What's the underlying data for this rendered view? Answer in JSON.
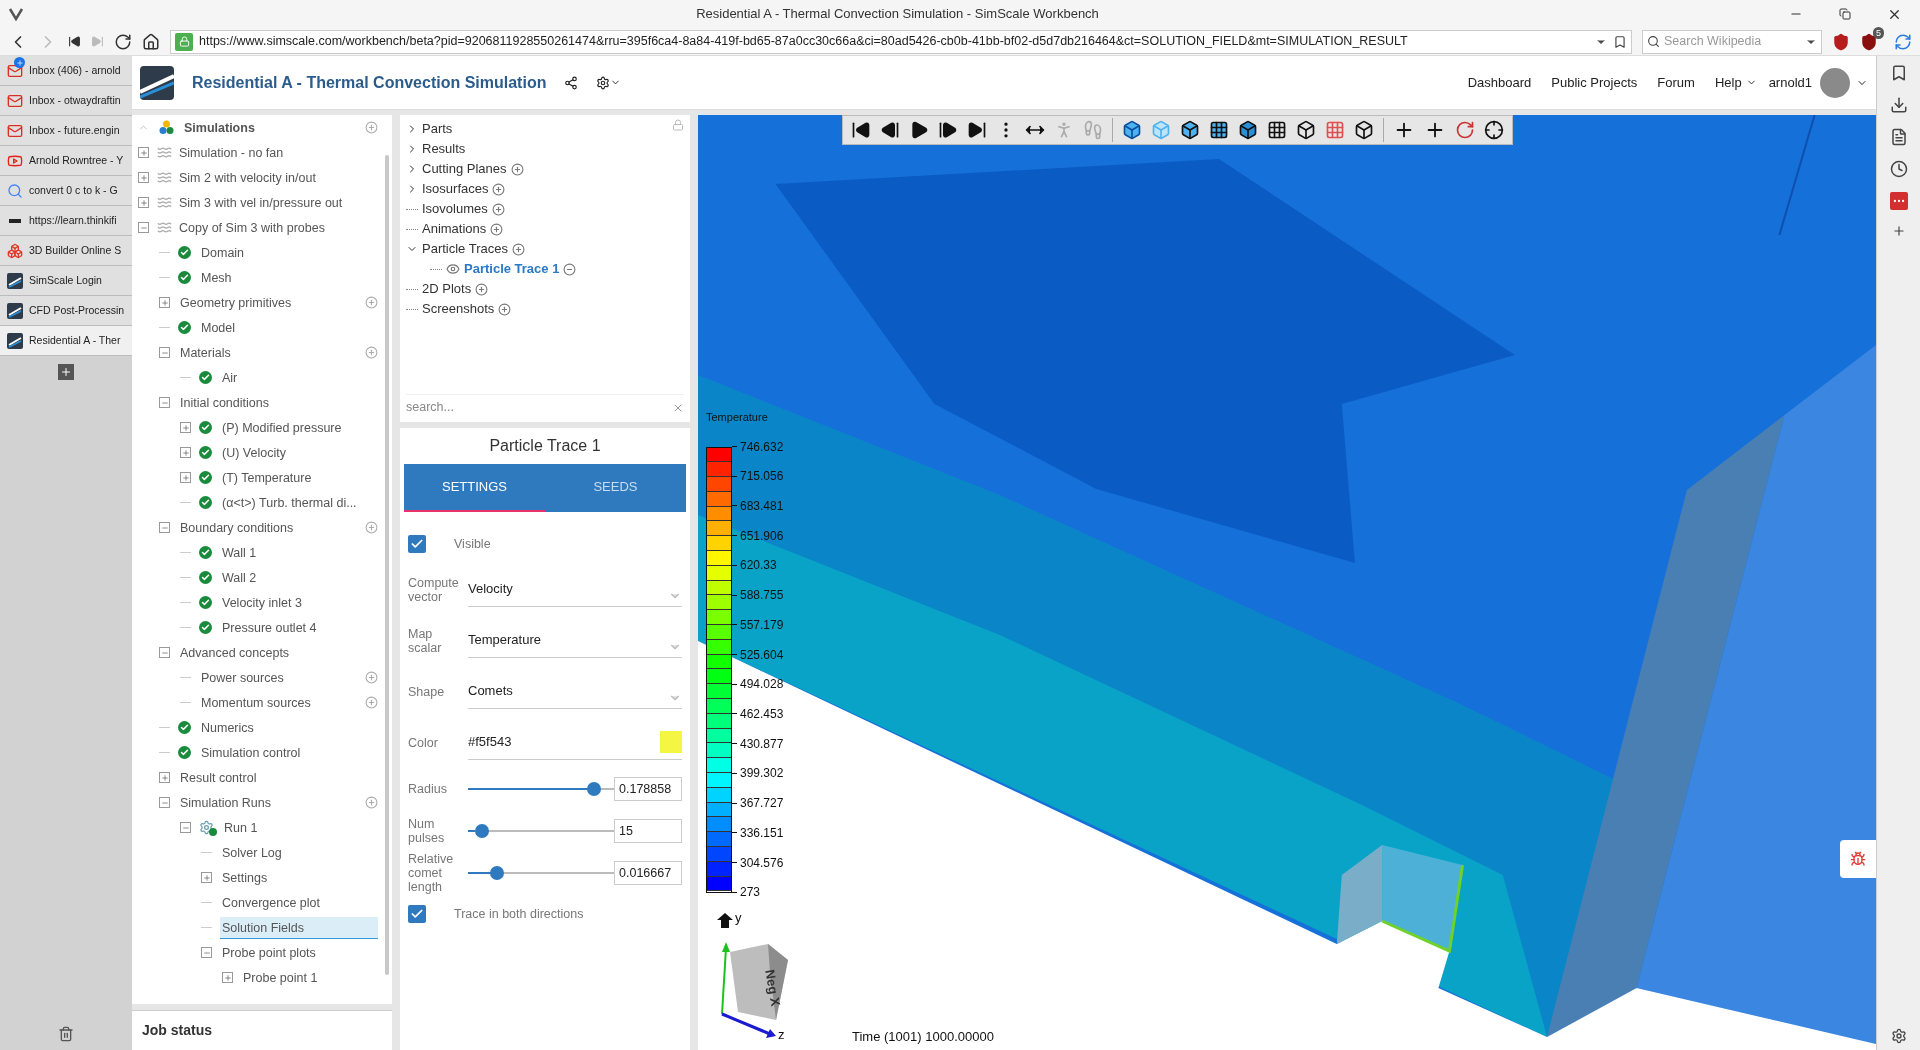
{
  "browser": {
    "title": "Residential A - Thermal Convection Simulation - SimScale Workbench",
    "url": "https://www.simscale.com/workbench/beta?pid=9206811928550261474&rru=395f6ca4-8a84-419f-bd65-87a0cc30c66a&ci=80ad5426-cb0b-41bb-bf02-d5d7db216464&ct=SOLUTION_FIELD&mt=SIMULATION_RESULT",
    "search_placeholder": "Search Wikipedia",
    "extension_badge": "5",
    "tabs": [
      {
        "label": "Inbox (406) - arnold",
        "kind": "mail",
        "badge": true,
        "selected": false
      },
      {
        "label": "Inbox - otwaydraftin",
        "kind": "mail",
        "badge": false,
        "selected": false
      },
      {
        "label": "Inbox - future.engin",
        "kind": "mail",
        "badge": false,
        "selected": false
      },
      {
        "label": "Arnold Rowntree - Y",
        "kind": "video",
        "badge": false,
        "selected": false
      },
      {
        "label": "convert 0 c to k - G",
        "kind": "search",
        "badge": false,
        "selected": false
      },
      {
        "label": "https://learn.thinkifi",
        "kind": "course",
        "badge": false,
        "selected": false
      },
      {
        "label": "3D Builder Online S",
        "kind": "builder",
        "badge": false,
        "selected": false
      },
      {
        "label": "SimScale Login",
        "kind": "app",
        "badge": false,
        "selected": false
      },
      {
        "label": "CFD Post-Processin",
        "kind": "app",
        "badge": false,
        "selected": false
      },
      {
        "label": "Residential A - Ther",
        "kind": "app",
        "badge": false,
        "selected": true
      }
    ]
  },
  "app_header": {
    "title": "Residential A - Thermal Convection Simulation",
    "nav": [
      {
        "label": "Dashboard",
        "dropdown": false
      },
      {
        "label": "Public Projects",
        "dropdown": false
      },
      {
        "label": "Forum",
        "dropdown": false
      },
      {
        "label": "Help",
        "dropdown": true
      }
    ],
    "user": "arnold1"
  },
  "simulation_tree": [
    {
      "label": "Simulations",
      "kind": "root",
      "expanded": true,
      "add": true,
      "selected": false,
      "children": [
        {
          "label": "Simulation - no fan",
          "kind": "sim",
          "expanded": false,
          "selected": false
        },
        {
          "label": "Sim 2 with velocity in/out",
          "kind": "sim",
          "expanded": false,
          "selected": false
        },
        {
          "label": "Sim 3 with vel in/pressure out",
          "kind": "sim",
          "expanded": false,
          "selected": false
        },
        {
          "label": "Copy of Sim 3 with probes",
          "kind": "sim",
          "expanded": true,
          "selected": false,
          "children": [
            {
              "label": "Domain",
              "kind": "check",
              "selected": false
            },
            {
              "label": "Mesh",
              "kind": "check",
              "selected": false
            },
            {
              "label": "Geometry primitives",
              "expanded": false,
              "add": true,
              "selected": false
            },
            {
              "label": "Model",
              "kind": "check",
              "selected": false
            },
            {
              "label": "Materials",
              "expanded": true,
              "add": true,
              "selected": false,
              "children": [
                {
                  "label": "Air",
                  "kind": "check",
                  "selected": false
                }
              ]
            },
            {
              "label": "Initial conditions",
              "expanded": true,
              "selected": false,
              "children": [
                {
                  "label": "(P) Modified pressure",
                  "kind": "check",
                  "expanded": false,
                  "selected": false
                },
                {
                  "label": "(U) Velocity",
                  "kind": "check",
                  "expanded": false,
                  "selected": false
                },
                {
                  "label": "(T) Temperature",
                  "kind": "check",
                  "expanded": false,
                  "selected": false
                },
                {
                  "label": "(α<t>) Turb. thermal di...",
                  "kind": "check",
                  "selected": false
                }
              ]
            },
            {
              "label": "Boundary conditions",
              "expanded": true,
              "add": true,
              "selected": false,
              "children": [
                {
                  "label": "Wall 1",
                  "kind": "check",
                  "selected": false
                },
                {
                  "label": "Wall 2",
                  "kind": "check",
                  "selected": false
                },
                {
                  "label": "Velocity inlet 3",
                  "kind": "check",
                  "selected": false
                },
                {
                  "label": "Pressure outlet 4",
                  "kind": "check",
                  "selected": false
                }
              ]
            },
            {
              "label": "Advanced concepts",
              "expanded": true,
              "selected": false,
              "children": [
                {
                  "label": "Power sources",
                  "add": true,
                  "selected": false
                },
                {
                  "label": "Momentum sources",
                  "add": true,
                  "selected": false
                }
              ]
            },
            {
              "label": "Numerics",
              "kind": "check",
              "selected": false
            },
            {
              "label": "Simulation control",
              "kind": "check",
              "selected": false
            },
            {
              "label": "Result control",
              "expanded": false,
              "selected": false
            },
            {
              "label": "Simulation Runs",
              "expanded": true,
              "add": true,
              "selected": false,
              "children": [
                {
                  "label": "Run 1",
                  "kind": "run",
                  "expanded": true,
                  "selected": false,
                  "children": [
                    {
                      "label": "Solver Log",
                      "selected": false
                    },
                    {
                      "label": "Settings",
                      "expanded": false,
                      "selected": false
                    },
                    {
                      "label": "Convergence plot",
                      "selected": false
                    },
                    {
                      "label": "Solution Fields",
                      "selected": true
                    },
                    {
                      "label": "Probe point plots",
                      "expanded": true,
                      "selected": false,
                      "children": [
                        {
                          "label": "Probe point 1",
                          "expanded": false,
                          "selected": false
                        }
                      ]
                    }
                  ]
                }
              ]
            }
          ]
        }
      ]
    }
  ],
  "job_status": {
    "title": "Job status"
  },
  "result_tree": {
    "items": [
      {
        "label": "Parts",
        "expanded": false,
        "add": false,
        "selected": false
      },
      {
        "label": "Results",
        "expanded": false,
        "add": false,
        "selected": false
      },
      {
        "label": "Cutting Planes",
        "expanded": false,
        "add": true,
        "selected": false
      },
      {
        "label": "Isosurfaces",
        "expanded": false,
        "add": true,
        "selected": false
      },
      {
        "label": "Isovolumes",
        "add": true,
        "selected": false
      },
      {
        "label": "Animations",
        "add": true,
        "selected": false
      },
      {
        "label": "Particle Traces",
        "expanded": true,
        "add": true,
        "selected": false,
        "children": [
          {
            "label": "Particle Trace 1",
            "add": false,
            "selected": true
          }
        ]
      },
      {
        "label": "2D Plots",
        "add": true,
        "selected": false
      },
      {
        "label": "Screenshots",
        "add": true,
        "selected": false
      }
    ],
    "search_placeholder": "search..."
  },
  "properties": {
    "title": "Particle Trace 1",
    "tabs": [
      {
        "label": "SETTINGS",
        "selected": true
      },
      {
        "label": "SEEDS",
        "selected": false
      }
    ],
    "fields": [
      {
        "kind": "checkbox",
        "label": "Visible",
        "checked": true
      },
      {
        "kind": "select",
        "label": "Compute vector",
        "value": "Velocity"
      },
      {
        "kind": "select",
        "label": "Map scalar",
        "value": "Temperature"
      },
      {
        "kind": "select",
        "label": "Shape",
        "value": "Comets"
      },
      {
        "kind": "color",
        "label": "Color",
        "value": "#f5f543",
        "color": "#f5f543"
      },
      {
        "kind": "slider",
        "label": "Radius",
        "level": 0.9,
        "value": "0.178858"
      },
      {
        "kind": "slider",
        "label": "Num pulses",
        "level": 0.05,
        "value": "15"
      },
      {
        "kind": "slider",
        "label": "Relative comet length",
        "level": 0.17,
        "value": "0.016667"
      },
      {
        "kind": "checkbox",
        "label": "Trace in both directions",
        "checked": true
      }
    ]
  },
  "viewport": {
    "legend": {
      "title": "Temperature",
      "labels": [
        "746.632",
        "715.056",
        "683.481",
        "651.906",
        "620.33",
        "588.755",
        "557.179",
        "525.604",
        "494.028",
        "462.453",
        "430.877",
        "399.302",
        "367.727",
        "336.151",
        "304.576",
        "273"
      ]
    },
    "axes": {
      "y": "y",
      "z": "z",
      "cube_face": "Neg X"
    },
    "time": "Time (1001) 1000.00000"
  }
}
